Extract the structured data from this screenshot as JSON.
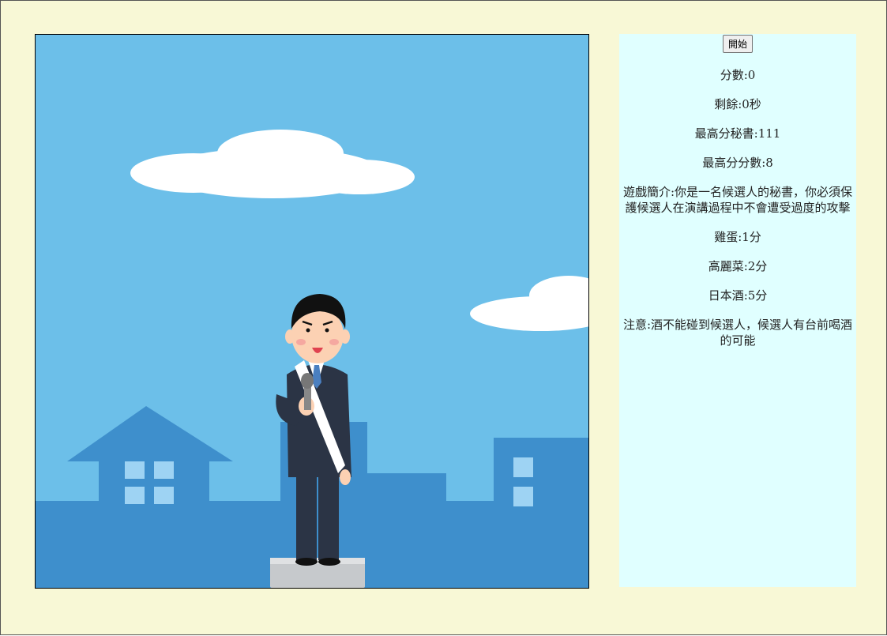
{
  "game": {
    "start_button": "開始",
    "score_label": "分數:0",
    "remaining_label": "剩餘:0秒",
    "high_secretary_label": "最高分秘書:111",
    "high_score_label": "最高分分數:8",
    "intro_text": "遊戲簡介:你是一名候選人的秘書，你必須保護候選人在演講過程中不會遭受過度的攻擊",
    "items": [
      "雞蛋:1分",
      "高麗菜:2分",
      "日本酒:5分"
    ],
    "note_text": "注意:酒不能碰到候選人，候選人有台前喝酒的可能"
  },
  "colors": {
    "page_bg": "#f8f8d6",
    "panel_bg": "#e0ffff",
    "sky": "#6cbfe9",
    "city": "#3e8fcc",
    "suit": "#2b3445"
  },
  "icons": {
    "candidate": "candidate-speaking-icon",
    "cloud": "cloud-icon",
    "podium": "podium-icon"
  }
}
